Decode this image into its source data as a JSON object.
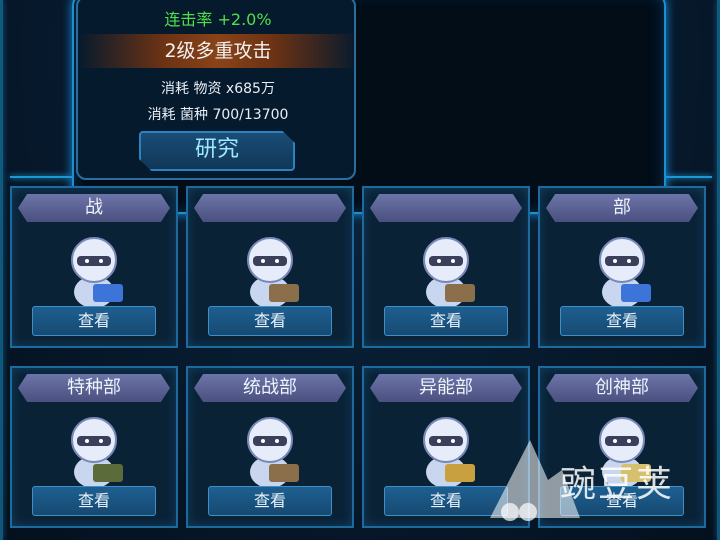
{
  "popup": {
    "combo_rate": "连击率 +2.0%",
    "skill_name": "2级多重攻击",
    "cost_supplies": "消耗 物资 x685万",
    "cost_strain": "消耗 菌种 700/13700",
    "research_label": "研究"
  },
  "departments": [
    {
      "name": "战",
      "button": "查看",
      "char_color": "#3d74d9"
    },
    {
      "name": "",
      "button": "查看",
      "char_color": "#8a6f4a"
    },
    {
      "name": "",
      "button": "查看",
      "char_color": "#8a6f4a"
    },
    {
      "name": "部",
      "button": "查看",
      "char_color": "#3d74d9"
    },
    {
      "name": "特种部",
      "button": "查看",
      "char_color": "#5b6b3a"
    },
    {
      "name": "统战部",
      "button": "查看",
      "char_color": "#8a6f4a"
    },
    {
      "name": "异能部",
      "button": "查看",
      "char_color": "#c8a040"
    },
    {
      "name": "创神部",
      "button": "查看",
      "char_color": "#d6c070"
    }
  ],
  "watermark": {
    "text": "豌豆荚"
  },
  "colors": {
    "accent_green": "#4fe04a",
    "frame_blue": "#1b8fd0",
    "button_blue": "#1e5f90",
    "tab_purple": "#5a61a0"
  }
}
